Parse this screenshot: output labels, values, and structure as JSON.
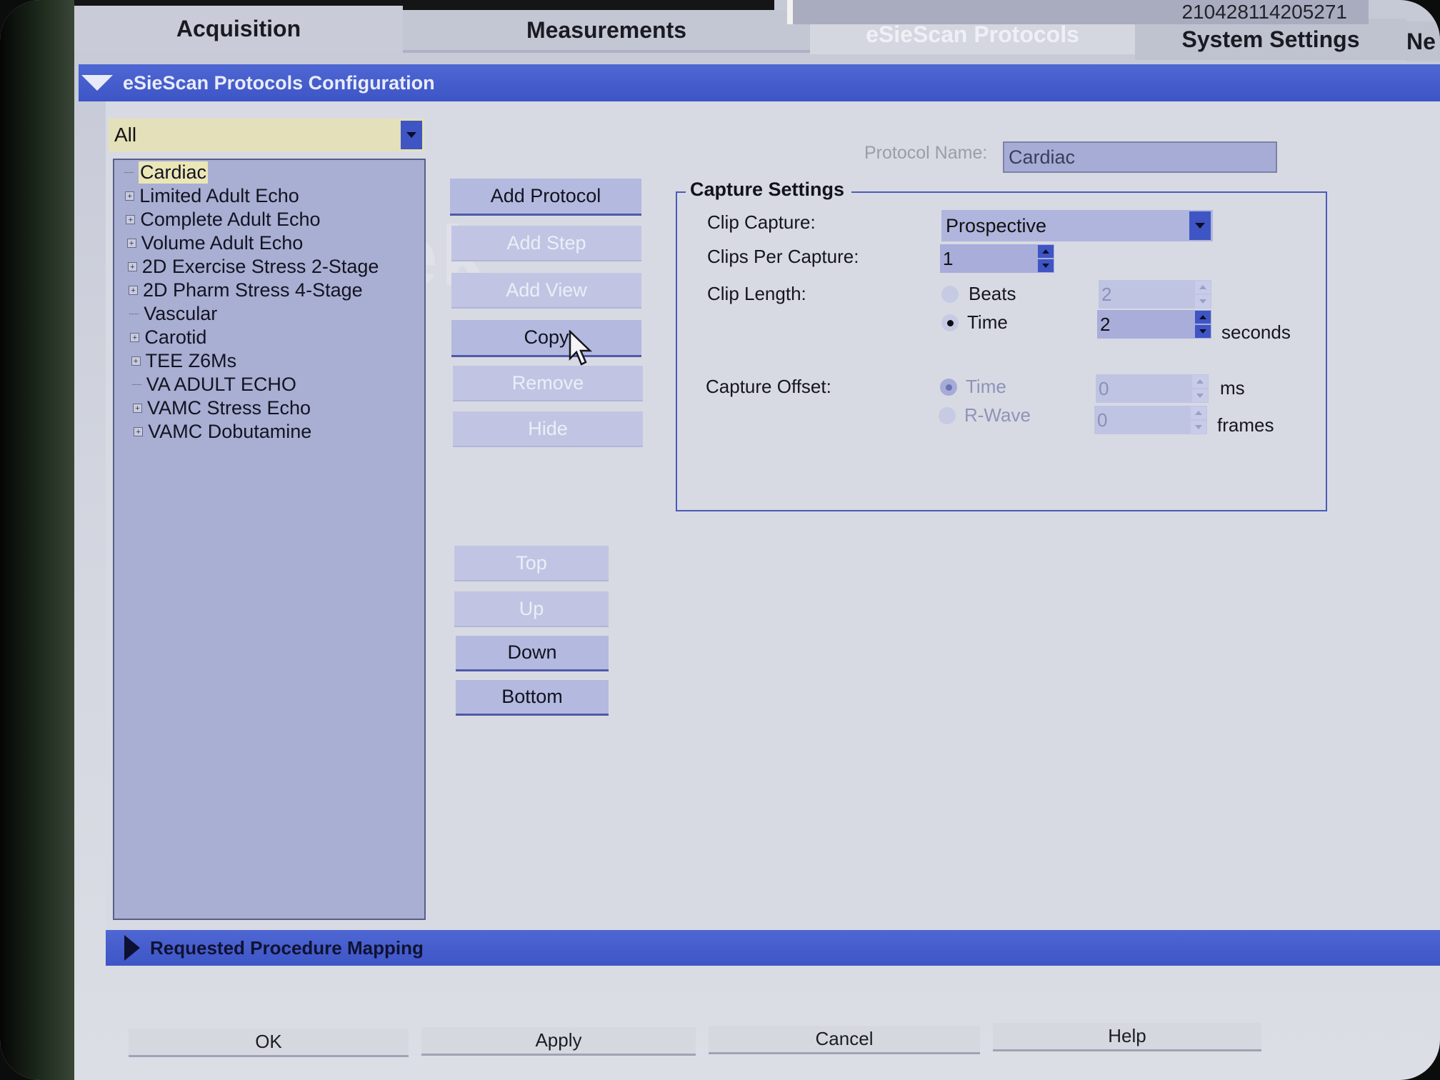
{
  "tabs": {
    "acquisition": "Acquisition",
    "measurements": "Measurements",
    "esiescan": "eSieScan Protocols",
    "system_settings": "System Settings",
    "next": "Ne"
  },
  "serial": "210428114205271",
  "config_header": "eSieScan Protocols Configuration",
  "filter": {
    "selected": "All"
  },
  "tree": {
    "items": [
      {
        "label": "Cardiac",
        "selected": true,
        "expandable": false
      },
      {
        "label": "Limited Adult Echo",
        "expandable": true
      },
      {
        "label": "Complete Adult Echo",
        "expandable": true
      },
      {
        "label": "Volume Adult Echo",
        "expandable": true
      },
      {
        "label": "2D Exercise Stress 2-Stage",
        "expandable": true
      },
      {
        "label": "2D Pharm Stress 4-Stage",
        "expandable": true
      },
      {
        "label": "Vascular",
        "expandable": false
      },
      {
        "label": "Carotid",
        "expandable": true
      },
      {
        "label": "TEE Z6Ms",
        "expandable": true
      },
      {
        "label": "VA ADULT ECHO",
        "expandable": false
      },
      {
        "label": "VAMC Stress Echo",
        "expandable": true
      },
      {
        "label": "VAMC Dobutamine",
        "expandable": true
      }
    ]
  },
  "actions": {
    "add_protocol": "Add Protocol",
    "add_step": "Add Step",
    "add_view": "Add View",
    "copy": "Copy",
    "remove": "Remove",
    "hide": "Hide",
    "top": "Top",
    "up": "Up",
    "down": "Down",
    "bottom": "Bottom"
  },
  "protocol": {
    "name_label": "Protocol Name:",
    "name_value": "Cardiac"
  },
  "capture": {
    "title": "Capture Settings",
    "clip_capture_label": "Clip Capture:",
    "clip_capture_value": "Prospective",
    "clips_per_capture_label": "Clips Per Capture:",
    "clips_per_capture_value": "1",
    "clip_length_label": "Clip Length:",
    "beats_label": "Beats",
    "beats_value": "2",
    "time_label": "Time",
    "time_value": "2",
    "seconds_unit": "seconds",
    "capture_offset_label": "Capture Offset:",
    "offset_time_label": "Time",
    "offset_time_value": "0",
    "ms_unit": "ms",
    "rwave_label": "R-Wave",
    "rwave_value": "0",
    "frames_unit": "frames"
  },
  "mapping_header": "Requested Procedure Mapping",
  "footer": {
    "ok": "OK",
    "apply": "Apply",
    "cancel": "Cancel",
    "help": "Help"
  },
  "watermark": "anTek",
  "colors": {
    "accent": "#3d55c6",
    "panel": "#d8dae3",
    "tree_bg": "#a9aed3",
    "selected": "#ebe6b6"
  }
}
